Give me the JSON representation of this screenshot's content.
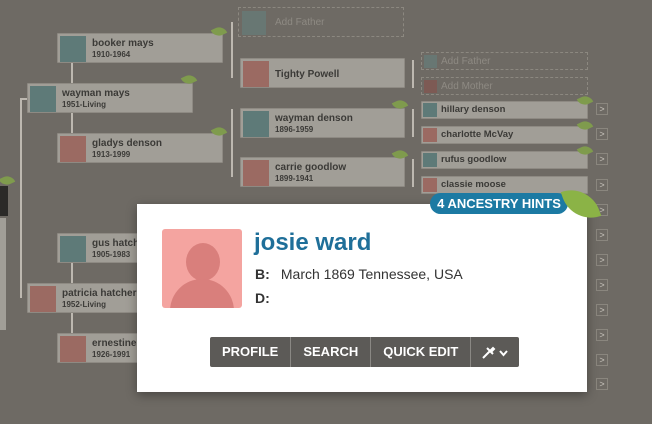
{
  "tree": {
    "people": [
      {
        "id": "booker",
        "name": "booker mays",
        "dates": "1910-1964",
        "gender": "male"
      },
      {
        "id": "tighty",
        "name": "Tighty Powell",
        "dates": "",
        "gender": "female"
      },
      {
        "id": "wayman_mays",
        "name": "wayman mays",
        "dates": "1951-Living",
        "gender": "male"
      },
      {
        "id": "gladys",
        "name": "gladys denson",
        "dates": "1913-1999",
        "gender": "female"
      },
      {
        "id": "wayman_denson",
        "name": "wayman denson",
        "dates": "1896-1959",
        "gender": "male"
      },
      {
        "id": "carrie",
        "name": "carrie goodlow",
        "dates": "1899-1941",
        "gender": "female"
      },
      {
        "id": "hillary",
        "name": "hillary denson",
        "gender": "male"
      },
      {
        "id": "charlotte",
        "name": "charlotte McVay",
        "gender": "female"
      },
      {
        "id": "rufus",
        "name": "rufus goodlow",
        "gender": "male"
      },
      {
        "id": "classie",
        "name": "classie moose",
        "gender": "female"
      },
      {
        "id": "gus",
        "name": "gus hatch",
        "dates": "1905-1983",
        "gender": "male"
      },
      {
        "id": "patricia",
        "name": "patricia hatcher",
        "dates": "1952-Living",
        "gender": "female"
      },
      {
        "id": "ernestine",
        "name": "ernestine",
        "dates": "1926-1991",
        "gender": "female"
      }
    ],
    "add_father": "Add Father",
    "add_mother": "Add Mother",
    "arrow_glyph": ">"
  },
  "popup": {
    "name": "josie ward",
    "birth_label": "B:",
    "birth_value": "March 1869 Tennessee, USA",
    "death_label": "D:",
    "death_value": "",
    "buttons": {
      "profile": "PROFILE",
      "search": "SEARCH",
      "quick_edit": "QUICK EDIT"
    },
    "tools_icon": "tools-icon",
    "hint_badge": "4 ANCESTRY HINTS"
  },
  "colors": {
    "accent": "#1f6f99",
    "hint": "#1c7aa3",
    "leaf": "#8bb346",
    "female_photo": "#f4a4a0"
  }
}
